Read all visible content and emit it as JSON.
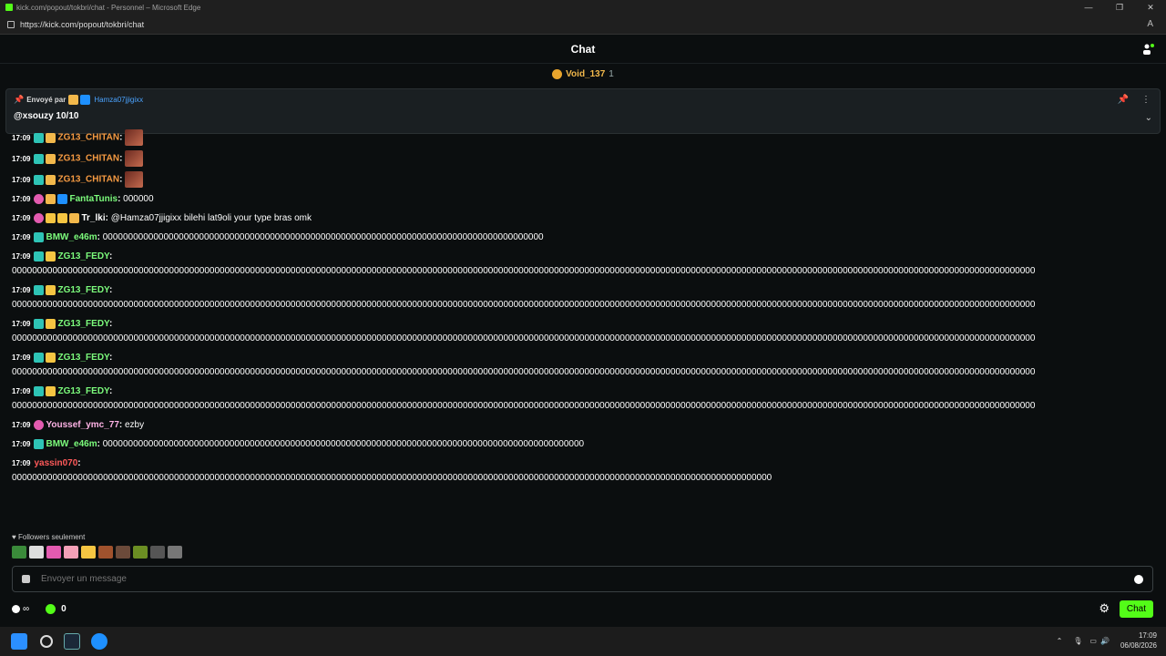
{
  "window": {
    "title": "kick.com/popout/tokbri/chat - Personnel – Microsoft Edge",
    "url": "https://kick.com/popout/tokbri/chat"
  },
  "chat": {
    "title": "Chat",
    "top_gifter": {
      "name": "Void_137",
      "count": "1"
    }
  },
  "pinned": {
    "sent_by_label": "Envoyé par",
    "author": "Hamza07jjigixx",
    "message": "@xsouzy 10/10"
  },
  "messages": [
    {
      "time": "17:09",
      "user": "ZG13_CHITAN",
      "color": "#f59a42",
      "text": ""
    },
    {
      "time": "17:09",
      "user": "ZG13_CHITAN",
      "color": "#f59a42",
      "text": ""
    },
    {
      "time": "17:09",
      "user": "ZG13_CHITAN",
      "color": "#f59a42",
      "text": ""
    },
    {
      "time": "17:09",
      "user": "FantaTunis",
      "color": "#7cfc7c",
      "text": "000000"
    },
    {
      "time": "17:09",
      "user": "Tr_lki",
      "color": "#ffffff",
      "text": "@Hamza07jjigixx bilehi lat9oli your type bras omk"
    },
    {
      "time": "17:09",
      "user": "BMW_e46m",
      "color": "#7cfc7c",
      "text": "000000000000000000000000000000000000000000000000000000000000000000000000000000000000000"
    },
    {
      "time": "17:09",
      "user": "ZG13_FEDY",
      "color": "#7cfc7c",
      "text": "0000000000000000000000000000000000000000000000000000000000000000000000000000000000000000000000000000000000000000000000000000000000000000000000000000000000000000000000000000000000000000000000000000000000"
    },
    {
      "time": "17:09",
      "user": "ZG13_FEDY",
      "color": "#7cfc7c",
      "text": "0000000000000000000000000000000000000000000000000000000000000000000000000000000000000000000000000000000000000000000000000000000000000000000000000000000000000000000000000000000000000000000000000000000000"
    },
    {
      "time": "17:09",
      "user": "ZG13_FEDY",
      "color": "#7cfc7c",
      "text": "0000000000000000000000000000000000000000000000000000000000000000000000000000000000000000000000000000000000000000000000000000000000000000000000000000000000000000000000000000000000000000000000000000000000"
    },
    {
      "time": "17:09",
      "user": "ZG13_FEDY",
      "color": "#7cfc7c",
      "text": "0000000000000000000000000000000000000000000000000000000000000000000000000000000000000000000000000000000000000000000000000000000000000000000000000000000000000000000000000000000000000000000000000000000000"
    },
    {
      "time": "17:09",
      "user": "ZG13_FEDY",
      "color": "#7cfc7c",
      "text": "0000000000000000000000000000000000000000000000000000000000000000000000000000000000000000000000000000000000000000000000000000000000000000000000000000000000000000000000000000000000000000000000000000000000"
    },
    {
      "time": "17:09",
      "user": "Youssef_ymc_77",
      "color": "#ffb3e6",
      "text": "ezby"
    },
    {
      "time": "17:09",
      "user": "BMW_e46m",
      "color": "#7cfc7c",
      "text": "00000000000000000000000000000000000000000000000000000000000000000000000000000000000000000000000"
    },
    {
      "time": "17:09",
      "user": "yassin070",
      "color": "#ff5a5a",
      "text": "000000000000000000000000000000000000000000000000000000000000000000000000000000000000000000000000000000000000000000000000000000000000000000000000000000"
    }
  ],
  "followers_only": "Followers seulement",
  "input": {
    "placeholder": "Envoyer un message"
  },
  "footer": {
    "infinity": "∞",
    "points": "0",
    "chat_button": "Chat"
  },
  "clock": {
    "time": "17:09",
    "date": "06/08/2026"
  }
}
